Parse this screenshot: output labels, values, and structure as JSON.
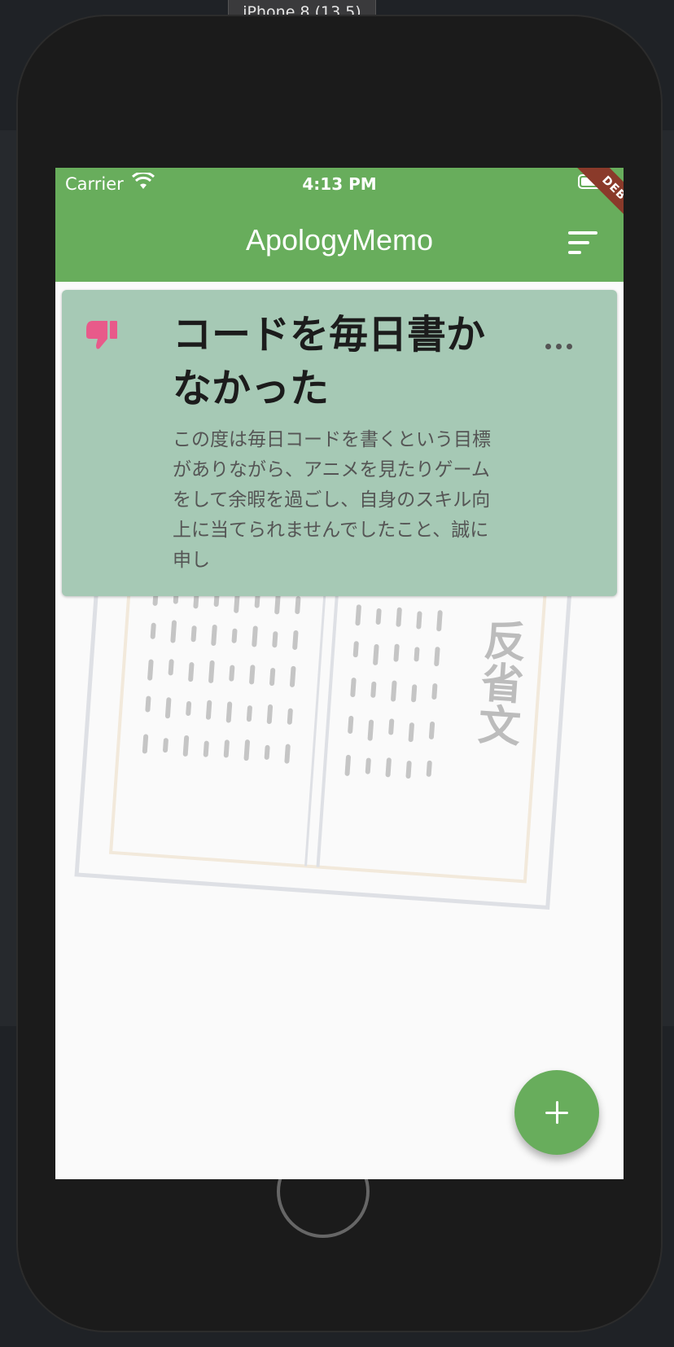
{
  "simulator": {
    "title": "iPhone 8 (13.5)"
  },
  "status_bar": {
    "carrier": "Carrier",
    "time": "4:13 PM"
  },
  "app_bar": {
    "title": "ApologyMemo",
    "sort_icon": "sort-icon"
  },
  "debug_banner": "DEBUG",
  "memo_card": {
    "icon": "thumb-down-icon",
    "title": "コードを毎日書かなかった",
    "body": "この度は毎日コードを書くという目標がありながら、アニメを見たりゲームをして余暇を過ごし、自身のスキル向上に当てられませんでしたこと、誠に申し",
    "menu_icon": "more-horiz-icon"
  },
  "illustration": {
    "label": "反省文"
  },
  "fab": {
    "icon": "plus-icon"
  },
  "colors": {
    "primary": "#68ad5c",
    "card": "#a6c9b5",
    "thumb": "#e85a8a"
  }
}
